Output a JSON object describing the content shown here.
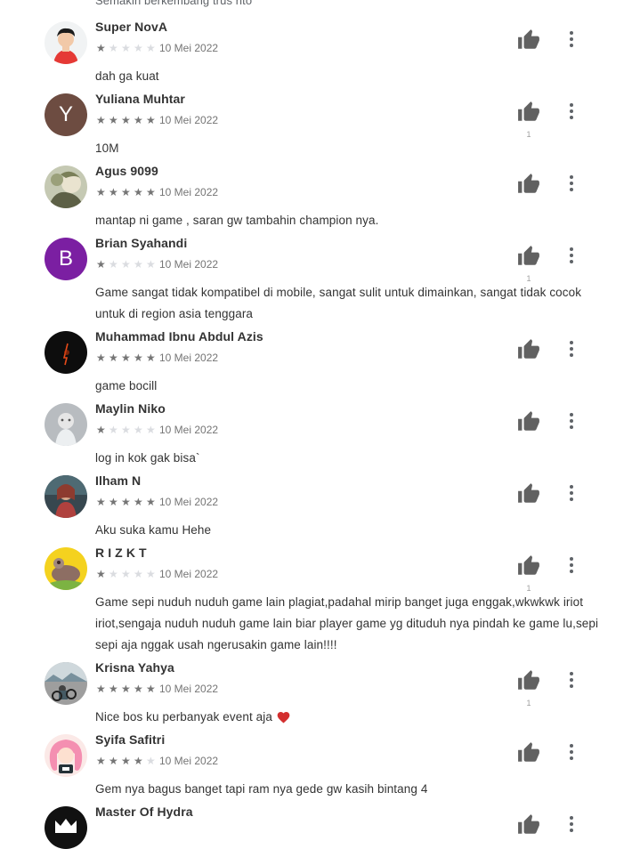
{
  "top_fragment": "Semakin berkembang trus rito",
  "reviews": [
    {
      "name": "Super NovA",
      "stars": 1,
      "date": "10 Mei 2022",
      "text": "dah ga kuat",
      "likes": "",
      "avatar": "man-portrait"
    },
    {
      "name": "Yuliana Muhtar",
      "stars": 5,
      "date": "10 Mei 2022",
      "text": "10M",
      "likes": "1",
      "avatar": "letter",
      "initial": "Y",
      "avatar_color": "#6d4c41"
    },
    {
      "name": "Agus 9099",
      "stars": 5,
      "date": "10 Mei 2022",
      "text": "mantap ni game , saran gw tambahin champion nya.",
      "likes": "",
      "avatar": "anime-photo"
    },
    {
      "name": "Brian Syahandi",
      "stars": 1,
      "date": "10 Mei 2022",
      "text": "Game sangat tidak kompatibel di mobile, sangat sulit untuk dimainkan, sangat tidak cocok untuk di region asia tenggara",
      "likes": "1",
      "avatar": "letter",
      "initial": "B",
      "avatar_color": "#7b1fa2"
    },
    {
      "name": "Muhammad Ibnu Abdul Azis",
      "stars": 5,
      "date": "10 Mei 2022",
      "text": "game bocill",
      "likes": "",
      "avatar": "dark-photo"
    },
    {
      "name": "Maylin Niko",
      "stars": 1,
      "date": "10 Mei 2022",
      "text": "log in kok gak bisa`",
      "likes": "",
      "avatar": "grey-photo"
    },
    {
      "name": "Ilham N",
      "stars": 5,
      "date": "10 Mei 2022",
      "text": "Aku suka kamu Hehe",
      "likes": "",
      "avatar": "teal-photo"
    },
    {
      "name": "R I Z K T",
      "stars": 1,
      "date": "10 Mei 2022",
      "text": "Game sepi nuduh nuduh game lain plagiat,padahal mirip banget juga enggak,wkwkwk iriot iriot,sengaja nuduh nuduh game lain biar player game yg dituduh nya pindah ke game lu,sepi sepi aja nggak usah ngerusakin game lain!!!!",
      "likes": "1",
      "avatar": "yellow-cartoon"
    },
    {
      "name": "Krisna Yahya",
      "stars": 5,
      "date": "10 Mei 2022",
      "text": "Nice bos ku perbanyak event aja",
      "likes": "1",
      "avatar": "outdoor-photo",
      "heart": true
    },
    {
      "name": "Syifa Safitri",
      "stars": 4,
      "date": "10 Mei 2022",
      "text": "Gem nya bagus banget tapi ram nya gede gw kasih bintang 4",
      "likes": "",
      "avatar": "pink-anime"
    },
    {
      "name": "Master Of Hydra",
      "stars": 0,
      "date": "",
      "text": "",
      "likes": "",
      "avatar": "hydra-logo"
    }
  ]
}
